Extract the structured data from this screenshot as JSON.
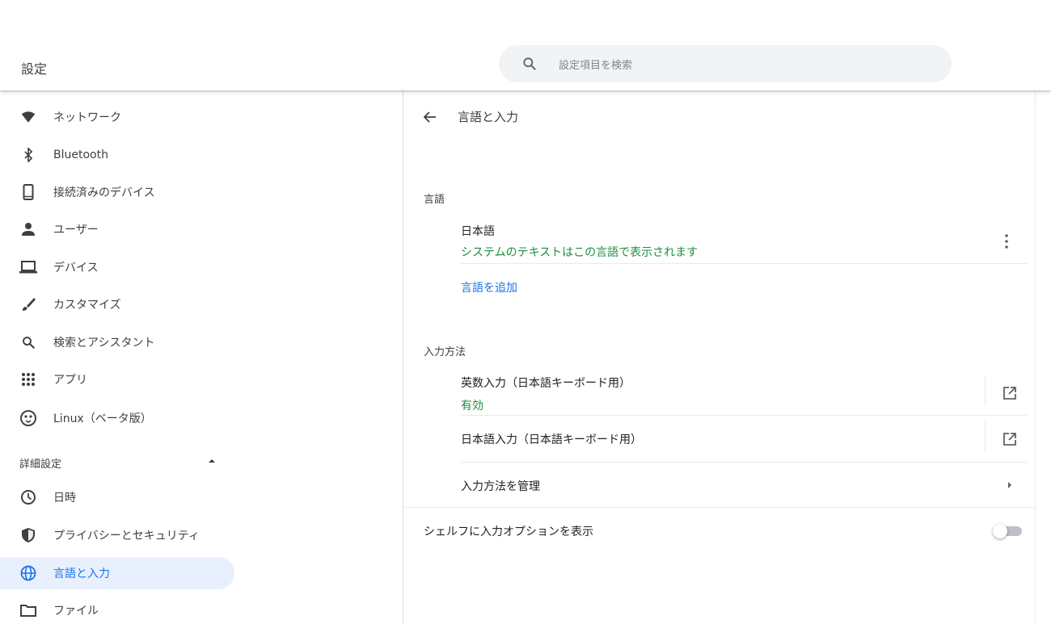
{
  "header": {
    "title": "設定",
    "search_placeholder": "設定項目を検索",
    "search_icon": "search-icon"
  },
  "sidebar": {
    "items": [
      {
        "label": "ネットワーク",
        "icon": "wifi-icon"
      },
      {
        "label": "Bluetooth",
        "icon": "bluetooth-icon"
      },
      {
        "label": "接続済みのデバイス",
        "icon": "phone-icon"
      },
      {
        "label": "ユーザー",
        "icon": "person-icon"
      },
      {
        "label": "デバイス",
        "icon": "laptop-icon"
      },
      {
        "label": "カスタマイズ",
        "icon": "brush-icon"
      },
      {
        "label": "検索とアシスタント",
        "icon": "search-icon"
      },
      {
        "label": "アプリ",
        "icon": "apps-grid-icon"
      },
      {
        "label": "Linux（ベータ版）",
        "icon": "linux-penguin-icon"
      }
    ],
    "advanced_label": "詳細設定",
    "advanced_items": [
      {
        "label": "日時",
        "icon": "clock-icon"
      },
      {
        "label": "プライバシーとセキュリティ",
        "icon": "shield-icon"
      },
      {
        "label": "言語と入力",
        "icon": "globe-icon",
        "active": true
      },
      {
        "label": "ファイル",
        "icon": "folder-icon"
      }
    ]
  },
  "main": {
    "page_title": "言語と入力",
    "language_section": {
      "heading": "言語",
      "language_name": "日本語",
      "language_status": "システムのテキストはこの言語で表示されます",
      "add_language": "言語を追加"
    },
    "input_section": {
      "heading": "入力方法",
      "methods": [
        {
          "name": "英数入力（日本語キーボード用）",
          "status": "有効"
        },
        {
          "name": "日本語入力（日本語キーボード用）",
          "status": ""
        }
      ],
      "manage": "入力方法を管理"
    },
    "shelf_option": {
      "label": "シェルフに入力オプションを表示",
      "enabled": false
    }
  },
  "colors": {
    "accent": "#1a73e8",
    "active_bg": "#e8f0fe",
    "status_green": "#1e8e3e",
    "search_bg": "#f1f3f4"
  }
}
